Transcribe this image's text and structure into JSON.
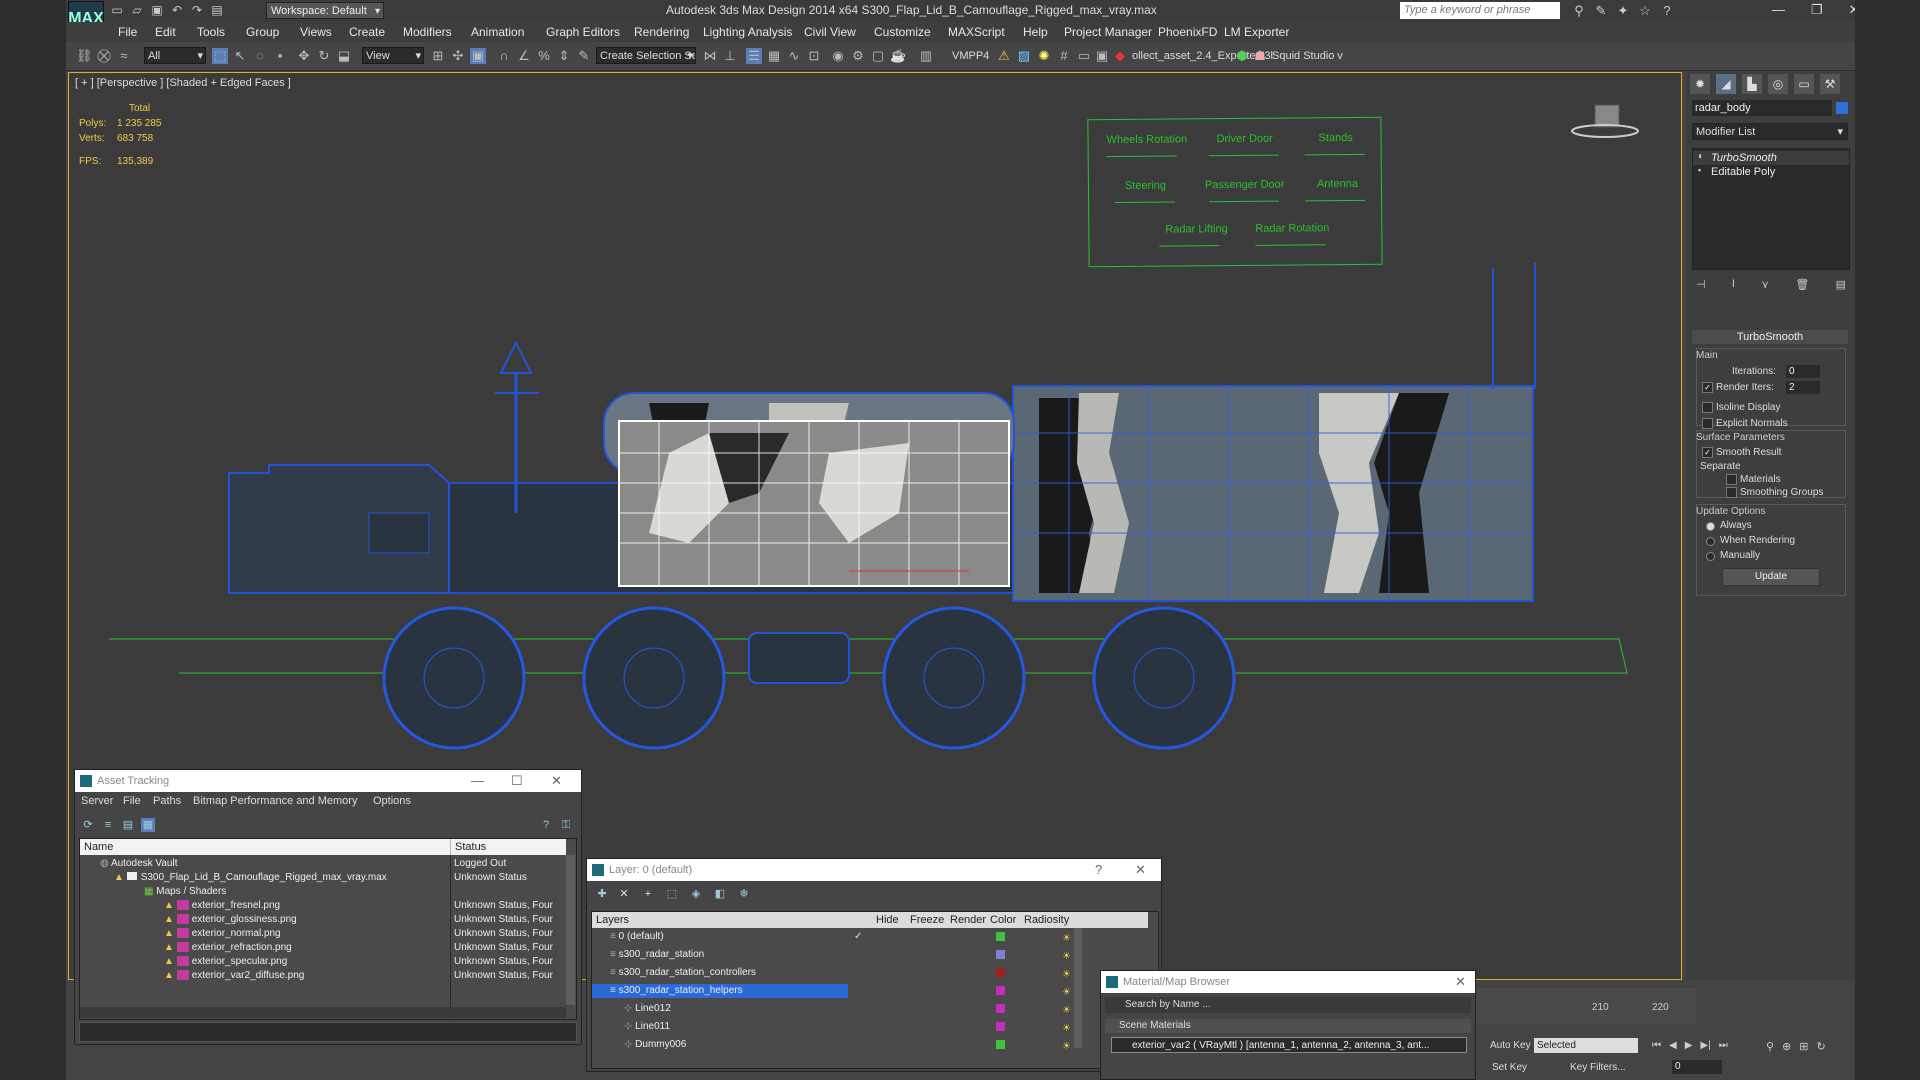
{
  "app": {
    "title": "Autodesk 3ds Max Design 2014 x64     S300_Flap_Lid_B_Camouflage_Rigged_max_vray.max",
    "logo_text": "MAX",
    "workspace": "Workspace: Default",
    "search_placeholder": "Type a keyword or phrase"
  },
  "menu": [
    "File",
    "Edit",
    "Tools",
    "Group",
    "Views",
    "Create",
    "Modifiers",
    "Animation",
    "Graph Editors",
    "Rendering",
    "Lighting Analysis",
    "Civil View",
    "Customize",
    "MAXScript",
    "Help",
    "Project Manager",
    "PhoenixFD",
    "LM Exporter"
  ],
  "toolbar": {
    "filter": "All",
    "ref_coord": "View",
    "selection_set": "Create Selection Se",
    "vmpp": "VMPP4",
    "exporter": "ollect_asset_2.4_Exporter '3l",
    "squid": "Squid Studio v"
  },
  "viewport": {
    "label": "[ + ] [Perspective ] [Shaded + Edged Faces ]",
    "stats": {
      "total": "Total",
      "polys_label": "Polys:",
      "polys": "1 235 285",
      "verts_label": "Verts:",
      "verts": "683 758",
      "fps_label": "FPS:",
      "fps": "135,389"
    },
    "rig_controls": [
      "Wheels Rotation",
      "Driver Door",
      "Stands",
      "Steering",
      "Passenger Door",
      "Antenna",
      "Radar Lifting",
      "Radar Rotation"
    ]
  },
  "cmdpanel": {
    "object_name": "radar_body",
    "modifier_list": "Modifier List",
    "stack": [
      "TurboSmooth",
      "Editable Poly"
    ],
    "rollout_title": "TurboSmooth",
    "main": "Main",
    "iterations_label": "Iterations:",
    "iterations": "0",
    "render_iters_label": "Render Iters:",
    "render_iters": "2",
    "isoline": "Isoline Display",
    "explicit": "Explicit Normals",
    "surface": "Surface Parameters",
    "smooth_result": "Smooth Result",
    "separate": "Separate",
    "materials": "Materials",
    "smoothing_groups": "Smoothing Groups",
    "update_options": "Update Options",
    "always": "Always",
    "when_rendering": "When Rendering",
    "manually": "Manually",
    "update": "Update"
  },
  "asset_tracking": {
    "title": "Asset Tracking",
    "menu": [
      "Server",
      "File",
      "Paths",
      "Bitmap Performance and Memory",
      "Options"
    ],
    "col_name": "Name",
    "col_status": "Status",
    "rows": [
      {
        "name": "Autodesk Vault",
        "status": "Logged Out"
      },
      {
        "name": "S300_Flap_Lid_B_Camouflage_Rigged_max_vray.max",
        "status": "Unknown Status"
      },
      {
        "name": "Maps / Shaders",
        "status": ""
      },
      {
        "name": "exterior_fresnel.png",
        "status": "Unknown Status, Four"
      },
      {
        "name": "exterior_glossiness.png",
        "status": "Unknown Status, Four"
      },
      {
        "name": "exterior_normal.png",
        "status": "Unknown Status, Four"
      },
      {
        "name": "exterior_refraction.png",
        "status": "Unknown Status, Four"
      },
      {
        "name": "exterior_specular.png",
        "status": "Unknown Status, Four"
      },
      {
        "name": "exterior_var2_diffuse.png",
        "status": "Unknown Status, Four"
      }
    ]
  },
  "layer": {
    "title": "Layer: 0 (default)",
    "help": "?",
    "cols": [
      "Layers",
      "Hide",
      "Freeze",
      "Render",
      "Color",
      "Radiosity"
    ],
    "rows": [
      {
        "name": "0 (default)",
        "color": "#3cc43c"
      },
      {
        "name": "s300_radar_station",
        "color": "#7f7fd8"
      },
      {
        "name": "s300_radar_station_controllers",
        "color": "#a02020"
      },
      {
        "name": "s300_radar_station_helpers",
        "color": "#c030c0"
      },
      {
        "name": "Line012",
        "color": "#c030c0"
      },
      {
        "name": "Line011",
        "color": "#c030c0"
      },
      {
        "name": "Dummy006",
        "color": "#3cc43c"
      }
    ]
  },
  "material_browser": {
    "title": "Material/Map Browser",
    "search": "Search by Name ...",
    "section": "Scene Materials",
    "item": "exterior_var2  ( VRayMtl )  [antenna_1, antenna_2, antenna_3, ant..."
  },
  "timeline": {
    "t1": "210",
    "t2": "220"
  },
  "anim": {
    "auto_key": "Auto Key",
    "set_key": "Set Key",
    "selected": "Selected",
    "key_filters": "Key Filters...",
    "frame": "0"
  }
}
